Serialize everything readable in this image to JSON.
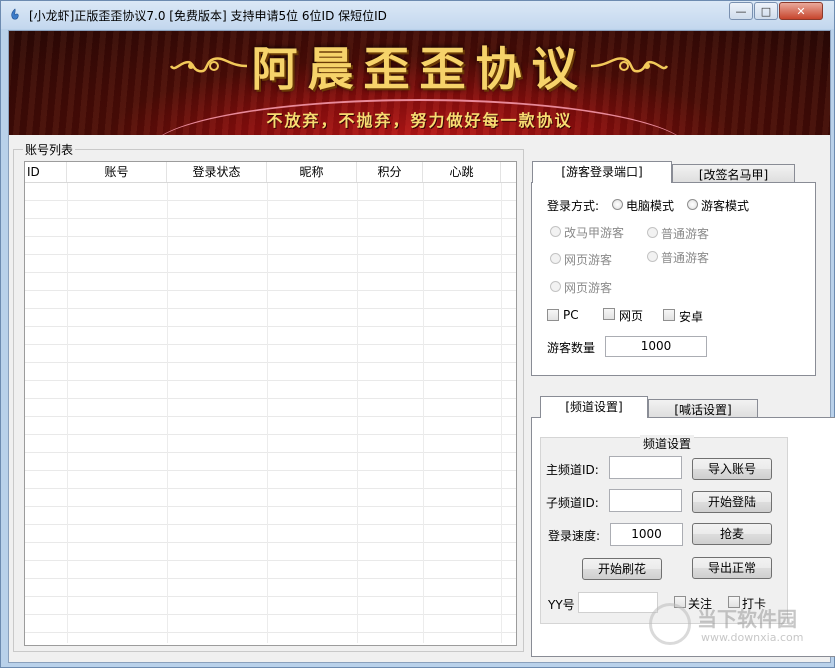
{
  "window": {
    "title": "[小龙虾]正版歪歪协议7.0 [免费版本] 支持申请5位 6位ID 保短位ID",
    "minimize_glyph": "—",
    "maximize_glyph": "□",
    "close_glyph": "✕"
  },
  "banner": {
    "title": "阿晨歪歪协议",
    "subtitle": "不放弃，不抛弃，努力做好每一款协议"
  },
  "account_list": {
    "label": "账号列表",
    "columns": [
      "ID",
      "账号",
      "登录状态",
      "昵称",
      "积分",
      "心跳"
    ]
  },
  "guest_panel": {
    "tabs": [
      "[游客登录端口]",
      "[改签名马甲]"
    ],
    "login_mode_label": "登录方式:",
    "mode_options": [
      "电脑模式",
      "游客模式"
    ],
    "guest_options": [
      "改马甲游客",
      "普通游客",
      "网页游客",
      "普通游客",
      "网页游客"
    ],
    "platforms": [
      "PC",
      "网页",
      "安卓"
    ],
    "guest_count_label": "游客数量",
    "guest_count_value": "1000"
  },
  "channel_panel": {
    "tabs": [
      "[频道设置]",
      "[喊话设置]"
    ],
    "group_title": "频道设置",
    "main_channel_label": "主频道ID:",
    "sub_channel_label": "子频道ID:",
    "login_speed_label": "登录速度:",
    "login_speed_value": "1000",
    "yy_label": "YY号",
    "buttons": {
      "import_accounts": "导入账号",
      "start_login": "开始登陆",
      "grab_mic": "抢麦",
      "start_flower": "开始刷花",
      "export_normal": "导出正常"
    },
    "follow_label": "关注",
    "checkin_label": "打卡"
  },
  "watermark": {
    "text": "当下软件园",
    "url": "www.downxia.com"
  }
}
